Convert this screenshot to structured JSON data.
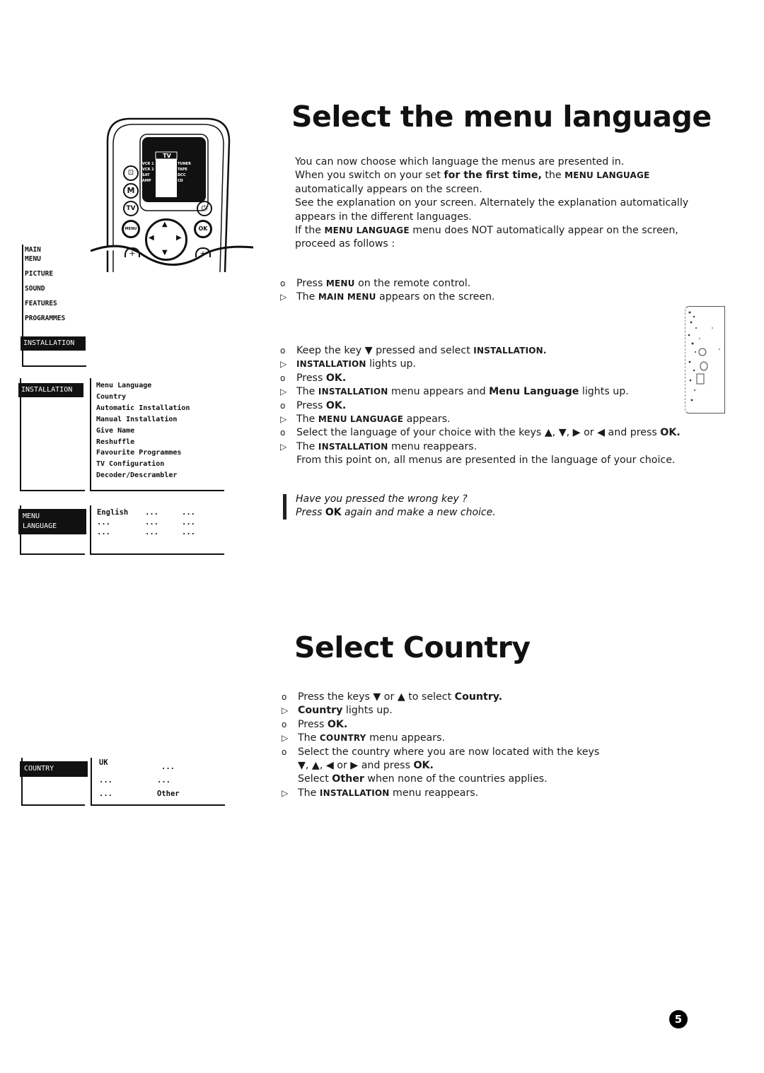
{
  "section1": {
    "title": "Select the menu language",
    "intro": {
      "line1": "You can now choose which language the menus are presented in.",
      "line2_a": "When you switch on your set ",
      "line2_b": "for the first time,",
      "line2_c": " the ",
      "line2_d": "MENU LANGUAGE",
      "line3": "automatically appears on the screen.",
      "line4": "See the explanation on your screen.  Alternately the explanation automatically",
      "line5": "appears in the different languages.",
      "line6_a": "If the ",
      "line6_b": "MENU LANGUAGE",
      "line6_c": " menu does NOT automatically appear on the screen,",
      "line7": "proceed as follows :"
    },
    "steps_a": [
      {
        "marker": "o",
        "parts": [
          "Press ",
          "MENU",
          " on the remote control."
        ]
      },
      {
        "marker": "▷",
        "parts": [
          "The ",
          "MAIN MENU",
          " appears on the screen."
        ]
      }
    ],
    "steps_b": [
      {
        "marker": "o",
        "parts": [
          "Keep the key ▼ pressed and select ",
          "INSTALLATION."
        ]
      },
      {
        "marker": "▷",
        "parts": [
          "INSTALLATION",
          " lights up."
        ]
      },
      {
        "marker": "o",
        "parts": [
          "Press ",
          "OK."
        ]
      },
      {
        "marker": "▷",
        "parts": [
          "The ",
          "INSTALLATION",
          " menu appears and ",
          "Menu Language",
          " lights up."
        ]
      },
      {
        "marker": "o",
        "parts": [
          "Press ",
          "OK."
        ]
      },
      {
        "marker": "▷",
        "parts": [
          "The ",
          "MENU LANGUAGE",
          " appears."
        ]
      },
      {
        "marker": "o",
        "parts": [
          "Select the language of your choice with the keys ▲, ▼, ▶ or ◀ and press ",
          "OK."
        ]
      },
      {
        "marker": "▷",
        "parts": [
          "The ",
          "INSTALLATION",
          " menu reappears."
        ]
      },
      {
        "marker": "",
        "parts": [
          "From this point on, all menus are presented in the language of your choice."
        ]
      }
    ],
    "note": {
      "line1": "Have you pressed the wrong key ?",
      "line2_a": "Press ",
      "line2_b": "OK",
      "line2_c": " again and make a new choice."
    }
  },
  "section2": {
    "title": "Select Country",
    "steps": [
      {
        "marker": "o",
        "parts": [
          "Press the keys ▼ or ▲  to select ",
          "Country."
        ]
      },
      {
        "marker": "▷",
        "parts": [
          "Country",
          " lights up."
        ]
      },
      {
        "marker": "o",
        "parts": [
          "Press ",
          "OK."
        ]
      },
      {
        "marker": "▷",
        "parts": [
          "The ",
          "COUNTRY",
          " menu appears."
        ]
      },
      {
        "marker": "o",
        "parts": [
          "Select the country where you are now located with the keys"
        ]
      },
      {
        "marker": "",
        "parts": [
          "▼, ▲, ◀ or ▶ and press ",
          "OK."
        ]
      },
      {
        "marker": "",
        "parts": [
          "Select ",
          "Other",
          " when none of the countries applies."
        ]
      },
      {
        "marker": "▷",
        "parts": [
          "The ",
          "INSTALLATION",
          " menu reappears."
        ]
      }
    ]
  },
  "remote": {
    "screen_title": "TV",
    "left_sources": [
      "VCR 1",
      "VCR 2",
      "SAT",
      "AMP"
    ],
    "right_sources": [
      "TUNER",
      "TAPE",
      "DCC",
      "CD"
    ],
    "buttons": {
      "input": "⊡",
      "m": "M",
      "tv": "TV",
      "power": "⏻",
      "menu": "MENU",
      "ok": "OK",
      "plus": "+"
    }
  },
  "main_menu": {
    "header": [
      "MAIN",
      "MENU"
    ],
    "items": [
      "PICTURE",
      "SOUND",
      "FEATURES",
      "PROGRAMMES"
    ],
    "selected": "INSTALLATION"
  },
  "installation_menu": {
    "label": "INSTALLATION",
    "items": [
      "Menu Language",
      "Country",
      "Automatic Installation",
      "Manual Installation",
      "Give Name",
      "Reshuffle",
      "Favourite Programmes",
      "TV Configuration",
      "Decoder/Descrambler"
    ]
  },
  "language_menu": {
    "label_line1": "MENU",
    "label_line2": "LANGUAGE",
    "grid": [
      [
        "English",
        "...",
        "..."
      ],
      [
        "...",
        "...",
        "..."
      ],
      [
        "...",
        "...",
        "..."
      ]
    ]
  },
  "country_menu": {
    "label": "COUNTRY",
    "grid": [
      [
        "UK",
        "..."
      ],
      [
        "...",
        "..."
      ],
      [
        "...",
        "Other"
      ]
    ]
  },
  "page_number": "5"
}
